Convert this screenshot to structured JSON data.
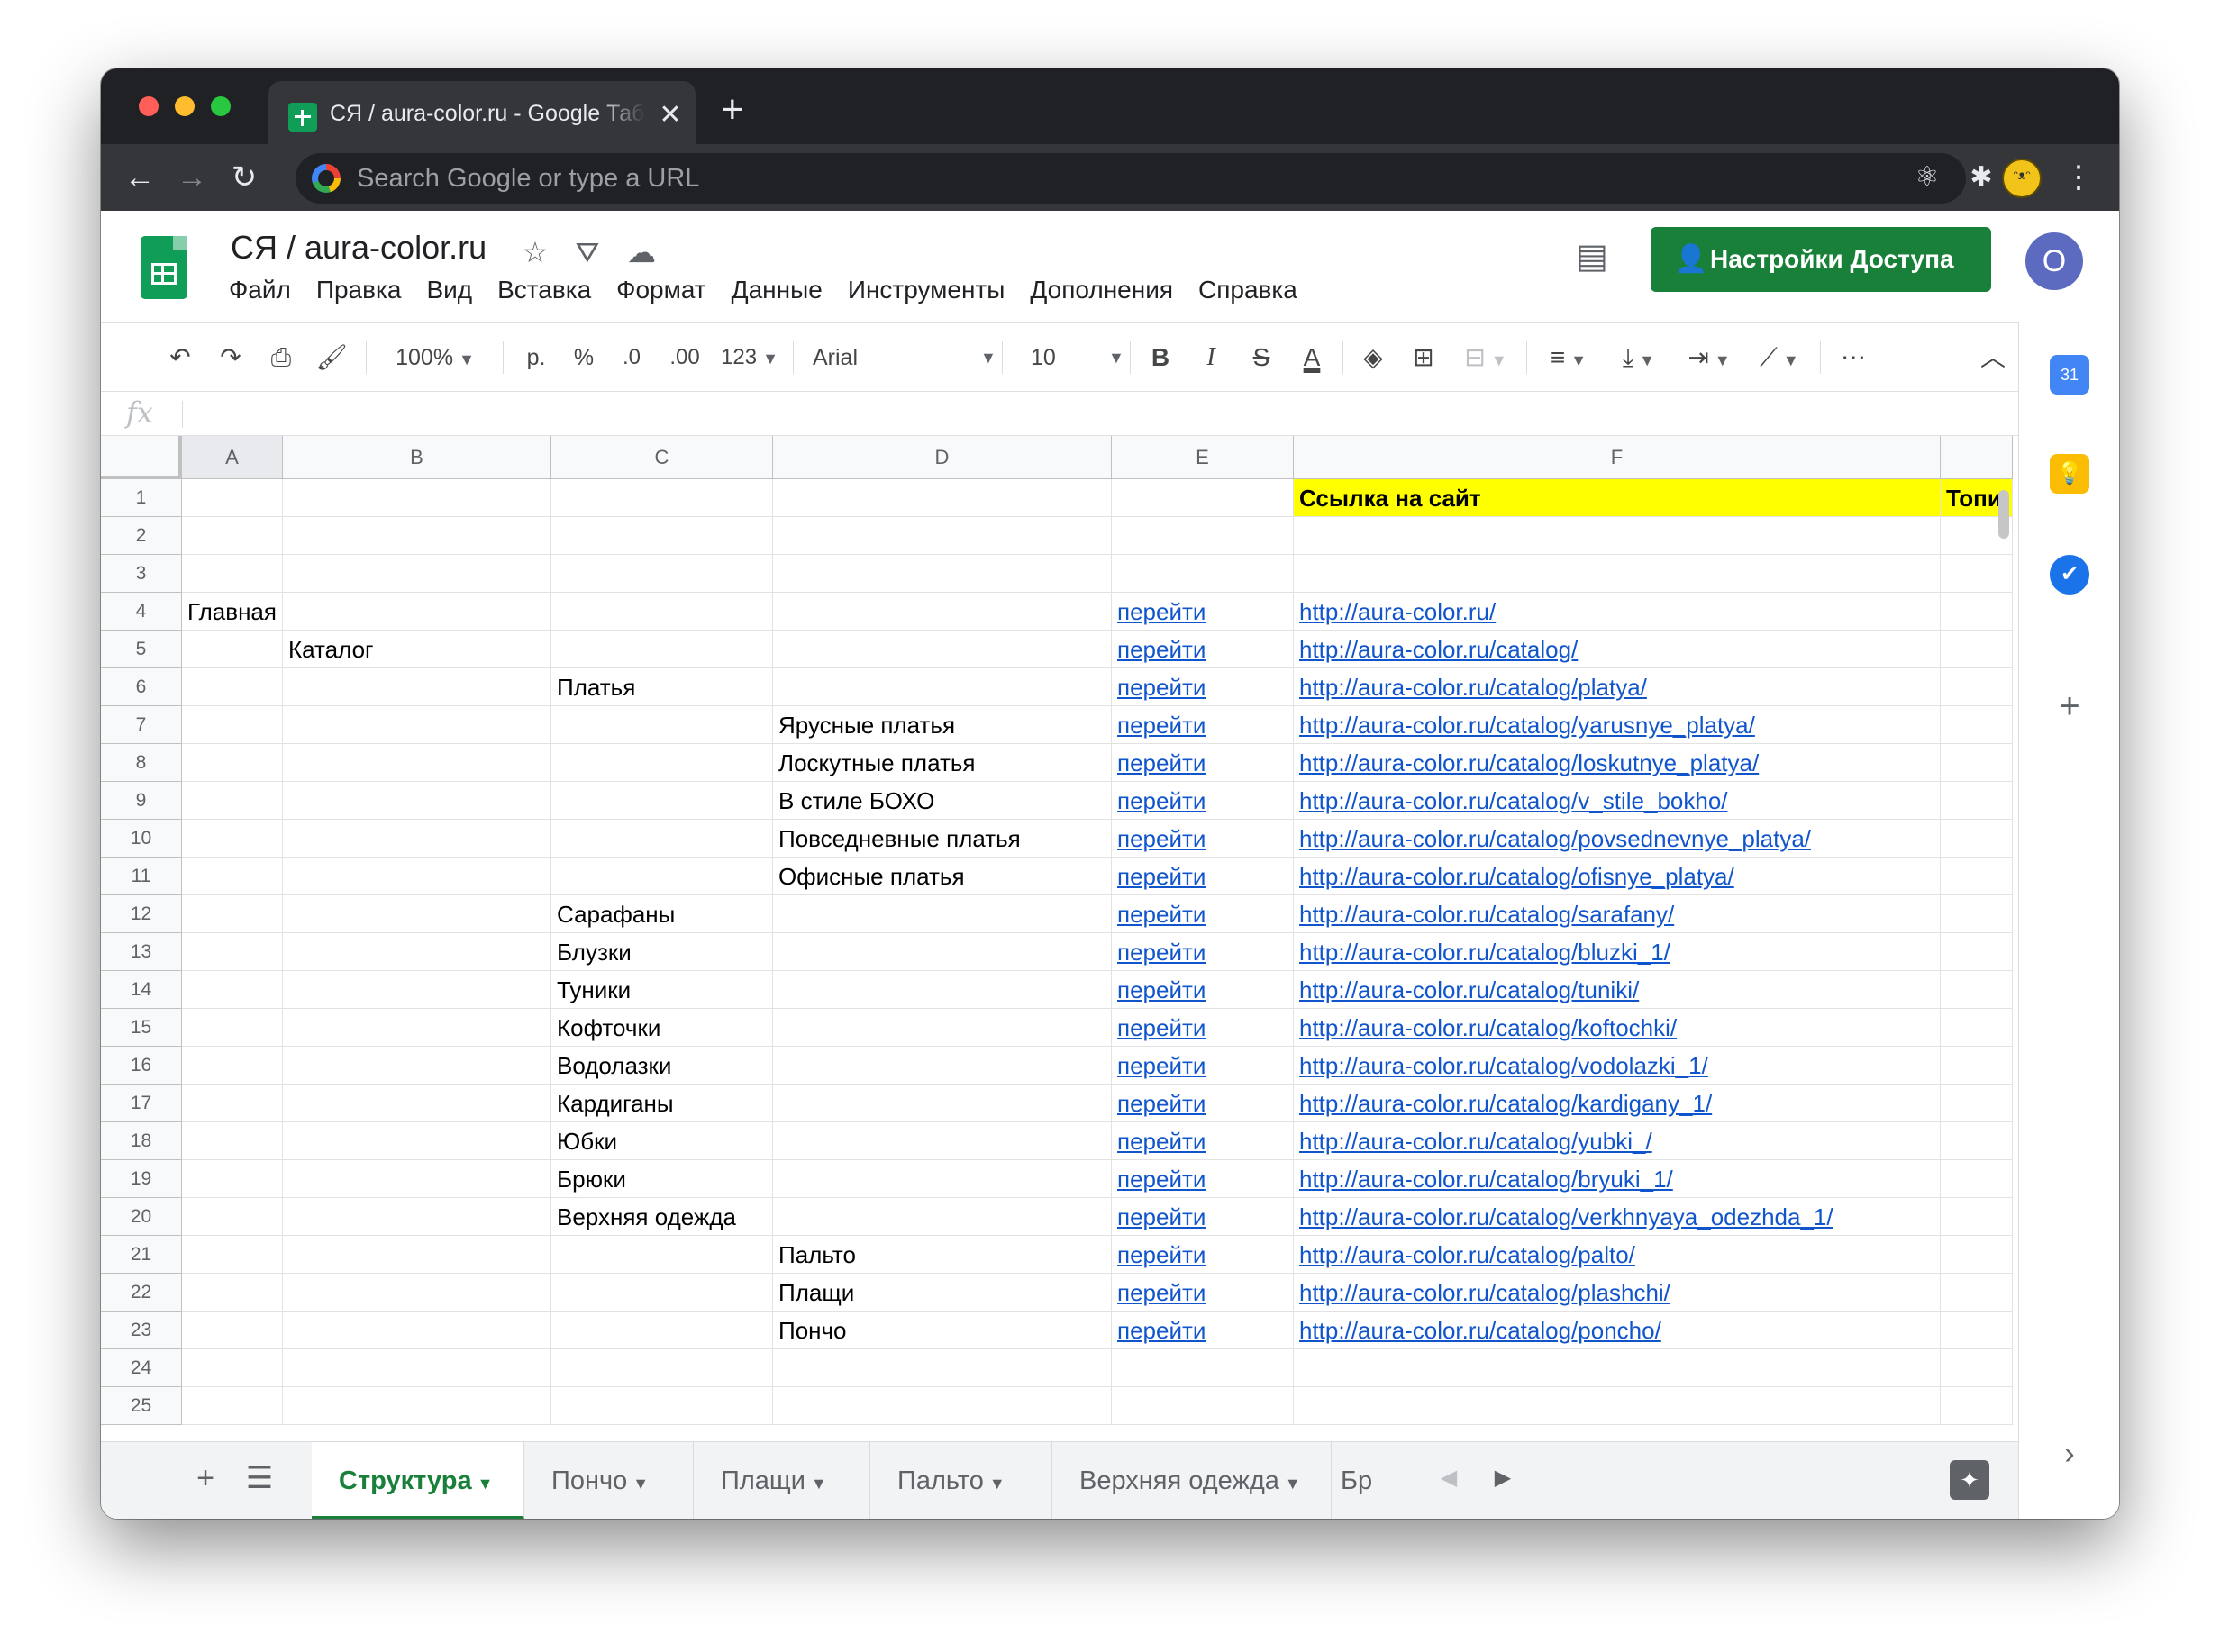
{
  "browser": {
    "tab_title": "СЯ / aura-color.ru - Google Таблицы",
    "tab_close": "✕",
    "new_tab": "+",
    "omnibox_placeholder": "Search Google or type a URL"
  },
  "header": {
    "doc_title": "СЯ / aura-color.ru",
    "menu": [
      "Файл",
      "Правка",
      "Вид",
      "Вставка",
      "Формат",
      "Данные",
      "Инструменты",
      "Дополнения",
      "Справка"
    ],
    "share_label": "Настройки Доступа",
    "account_initial": "О"
  },
  "toolbar": {
    "zoom": "100%",
    "currency": "р.",
    "percent": "%",
    "decrease_decimal": ".0",
    "increase_decimal": ".00",
    "number_format": "123",
    "font": "Arial",
    "font_size": "10",
    "bold": "B",
    "italic": "I",
    "strike": "S",
    "text_color": "A",
    "more": "⋯"
  },
  "formula_bar": {
    "fx": "fx",
    "value": ""
  },
  "grid": {
    "columns": [
      "A",
      "B",
      "C",
      "D",
      "E",
      "F"
    ],
    "rows": [
      {
        "n": "1",
        "a": "",
        "b": "",
        "c": "",
        "d": "",
        "e": "",
        "f": "Ссылка на сайт",
        "g": "Топи"
      },
      {
        "n": "2",
        "a": "",
        "b": "",
        "c": "",
        "d": "",
        "e": "",
        "f": "",
        "g": ""
      },
      {
        "n": "3",
        "a": "",
        "b": "",
        "c": "",
        "d": "",
        "e": "",
        "f": "",
        "g": ""
      },
      {
        "n": "4",
        "a": "Главная",
        "b": "",
        "c": "",
        "d": "",
        "e": "перейти",
        "f": "http://aura-color.ru/",
        "g": ""
      },
      {
        "n": "5",
        "a": "",
        "b": "Каталог",
        "c": "",
        "d": "",
        "e": "перейти",
        "f": "http://aura-color.ru/catalog/",
        "g": ""
      },
      {
        "n": "6",
        "a": "",
        "b": "",
        "c": "Платья",
        "d": "",
        "e": "перейти",
        "f": "http://aura-color.ru/catalog/platya/",
        "g": ""
      },
      {
        "n": "7",
        "a": "",
        "b": "",
        "c": "",
        "d": "Ярусные платья",
        "e": "перейти",
        "f": "http://aura-color.ru/catalog/yarusnye_platya/",
        "g": ""
      },
      {
        "n": "8",
        "a": "",
        "b": "",
        "c": "",
        "d": "Лоскутные платья",
        "e": "перейти",
        "f": "http://aura-color.ru/catalog/loskutnye_platya/",
        "g": ""
      },
      {
        "n": "9",
        "a": "",
        "b": "",
        "c": "",
        "d": "В стиле БОХО",
        "e": "перейти",
        "f": "http://aura-color.ru/catalog/v_stile_bokho/",
        "g": ""
      },
      {
        "n": "10",
        "a": "",
        "b": "",
        "c": "",
        "d": "Повседневные платья",
        "e": "перейти",
        "f": "http://aura-color.ru/catalog/povsednevnye_platya/",
        "g": ""
      },
      {
        "n": "11",
        "a": "",
        "b": "",
        "c": "",
        "d": "Офисные платья",
        "e": "перейти",
        "f": "http://aura-color.ru/catalog/ofisnye_platya/",
        "g": ""
      },
      {
        "n": "12",
        "a": "",
        "b": "",
        "c": "Сарафаны",
        "d": "",
        "e": "перейти",
        "f": "http://aura-color.ru/catalog/sarafany/",
        "g": ""
      },
      {
        "n": "13",
        "a": "",
        "b": "",
        "c": "Блузки",
        "d": "",
        "e": "перейти",
        "f": "http://aura-color.ru/catalog/bluzki_1/",
        "g": ""
      },
      {
        "n": "14",
        "a": "",
        "b": "",
        "c": "Туники",
        "d": "",
        "e": "перейти",
        "f": "http://aura-color.ru/catalog/tuniki/",
        "g": ""
      },
      {
        "n": "15",
        "a": "",
        "b": "",
        "c": "Кофточки",
        "d": "",
        "e": "перейти",
        "f": "http://aura-color.ru/catalog/koftochki/",
        "g": ""
      },
      {
        "n": "16",
        "a": "",
        "b": "",
        "c": "Водолазки",
        "d": "",
        "e": "перейти",
        "f": "http://aura-color.ru/catalog/vodolazki_1/",
        "g": ""
      },
      {
        "n": "17",
        "a": "",
        "b": "",
        "c": "Кардиганы",
        "d": "",
        "e": "перейти",
        "f": "http://aura-color.ru/catalog/kardigany_1/",
        "g": ""
      },
      {
        "n": "18",
        "a": "",
        "b": "",
        "c": "Юбки",
        "d": "",
        "e": "перейти",
        "f": "http://aura-color.ru/catalog/yubki_/",
        "g": ""
      },
      {
        "n": "19",
        "a": "",
        "b": "",
        "c": "Брюки",
        "d": "",
        "e": "перейти",
        "f": "http://aura-color.ru/catalog/bryuki_1/",
        "g": ""
      },
      {
        "n": "20",
        "a": "",
        "b": "",
        "c": "Верхняя одежда",
        "d": "",
        "e": "перейти",
        "f": "http://aura-color.ru/catalog/verkhnyaya_odezhda_1/",
        "g": ""
      },
      {
        "n": "21",
        "a": "",
        "b": "",
        "c": "",
        "d": "Пальто",
        "e": "перейти",
        "f": "http://aura-color.ru/catalog/palto/",
        "g": ""
      },
      {
        "n": "22",
        "a": "",
        "b": "",
        "c": "",
        "d": "Плащи",
        "e": "перейти",
        "f": "http://aura-color.ru/catalog/plashchi/",
        "g": ""
      },
      {
        "n": "23",
        "a": "",
        "b": "",
        "c": "",
        "d": "Пончо",
        "e": "перейти",
        "f": "http://aura-color.ru/catalog/poncho/",
        "g": ""
      },
      {
        "n": "24",
        "a": "",
        "b": "",
        "c": "",
        "d": "",
        "e": "",
        "f": "",
        "g": ""
      },
      {
        "n": "25",
        "a": "",
        "b": "",
        "c": "",
        "d": "",
        "e": "",
        "f": "",
        "g": ""
      }
    ]
  },
  "sheet_tabs": [
    "Структура",
    "Пончо",
    "Плащи",
    "Пальто",
    "Верхняя одежда",
    "Бр"
  ],
  "colors": {
    "accent_green": "#188038",
    "link": "#1155cc",
    "highlight": "#ffff00",
    "account": "#5c6bc0"
  }
}
